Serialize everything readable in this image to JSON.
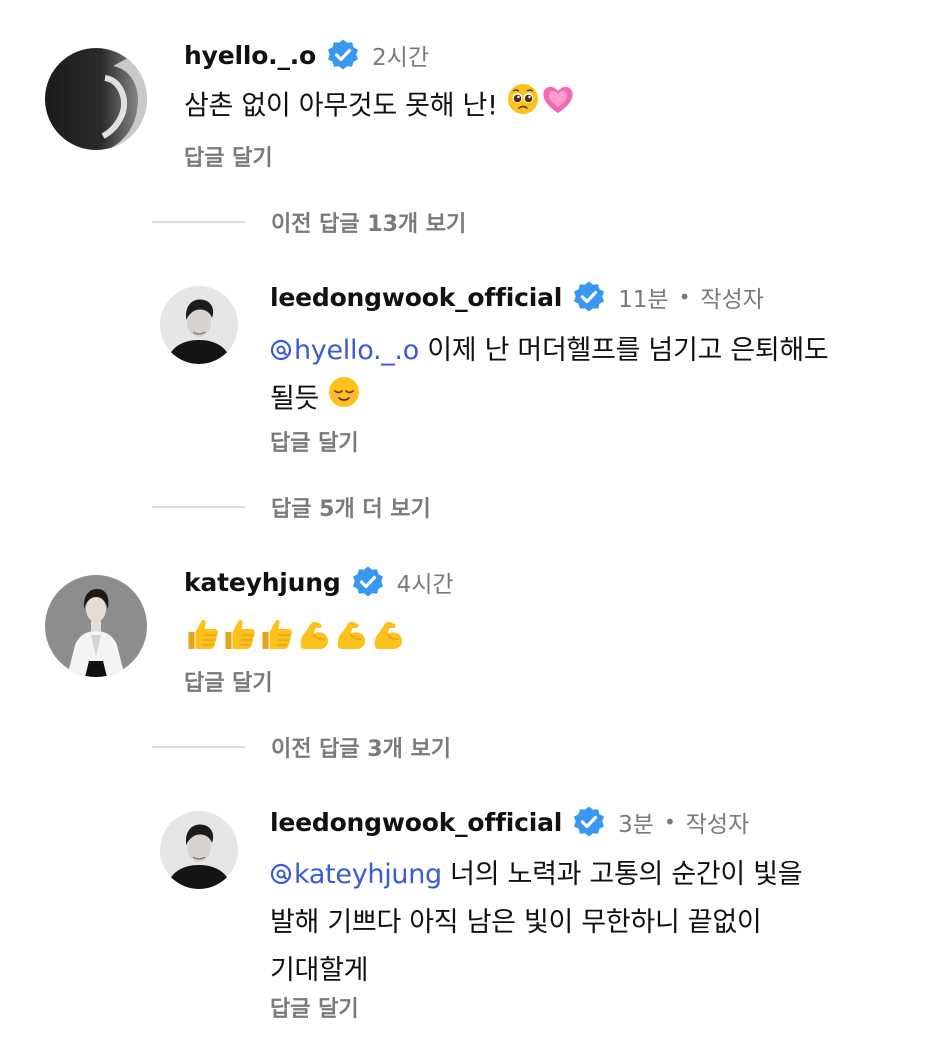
{
  "comments": [
    {
      "username": "hyello._.o",
      "time": "2시간",
      "text": "삼촌 없이 아무것도 못해 난!",
      "reply_label": "답글 달기",
      "emojis": [
        "pleading-face",
        "growing-heart"
      ]
    },
    {
      "username": "leedongwook_official",
      "time": "11분",
      "author_label": "작성자",
      "mention": "hyello._.o",
      "text_line1": "이제 난 머더헬프를 넘기고 은퇴해도",
      "text_line2": "될듯",
      "reply_label": "답글 달기",
      "emojis": [
        "relieved-face"
      ]
    },
    {
      "username": "kateyhjung",
      "time": "4시간",
      "reply_label": "답글 달기",
      "emojis": [
        "thumbs-up",
        "thumbs-up",
        "thumbs-up",
        "flexed-biceps",
        "flexed-biceps",
        "flexed-biceps"
      ]
    },
    {
      "username": "leedongwook_official",
      "time": "3분",
      "author_label": "작성자",
      "mention": "kateyhjung",
      "text_line1": "너의 노력과 고통의 순간이 빛을",
      "text_line2": "발해 기쁘다 아직 남은 빛이 무한하니 끝없이",
      "text_line3": "기대할게",
      "reply_label": "답글 달기"
    }
  ],
  "view_more": {
    "prev_replies_13": "이전 답글 13개 보기",
    "more_replies_5": "답글 5개 더 보기",
    "prev_replies_3": "이전 답글 3개 보기"
  },
  "separator": "•",
  "colors": {
    "mention": "#3b5bd6",
    "verified": "#3897f0",
    "secondary_text": "#7a7a7a"
  }
}
